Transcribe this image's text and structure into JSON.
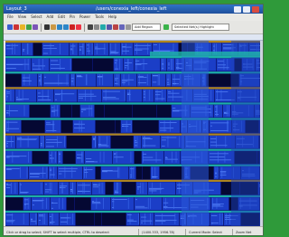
{
  "window": {
    "title": "Layout_3",
    "path": "/users/conexia_left/conexia_left"
  },
  "menu": {
    "items": [
      "File",
      "View",
      "Select",
      "Add",
      "Edit",
      "Pin",
      "Power",
      "Tools",
      "Help"
    ]
  },
  "toolbar": {
    "layer_select": "Add Region",
    "view_select": "Selected Net(s) Highlight"
  },
  "status": {
    "hint": "Click or drag to select; SHIFT to select multiple, CTRL to deselect",
    "coords": "(1400.333, 1956.78)",
    "mode": "Current Mode: Select",
    "zoom": "Zoom Net"
  },
  "colors": {
    "desktop": "#2f9a3a",
    "canvas_bg": "#0c1470",
    "cell_blue": "#1f45d6",
    "power_rail_orange": "#b98d1a",
    "power_rail_teal": "#1fb7a9"
  },
  "icons": [
    "app-icon",
    "minimize-window-icon",
    "maximize-window-icon",
    "close-window-icon"
  ]
}
